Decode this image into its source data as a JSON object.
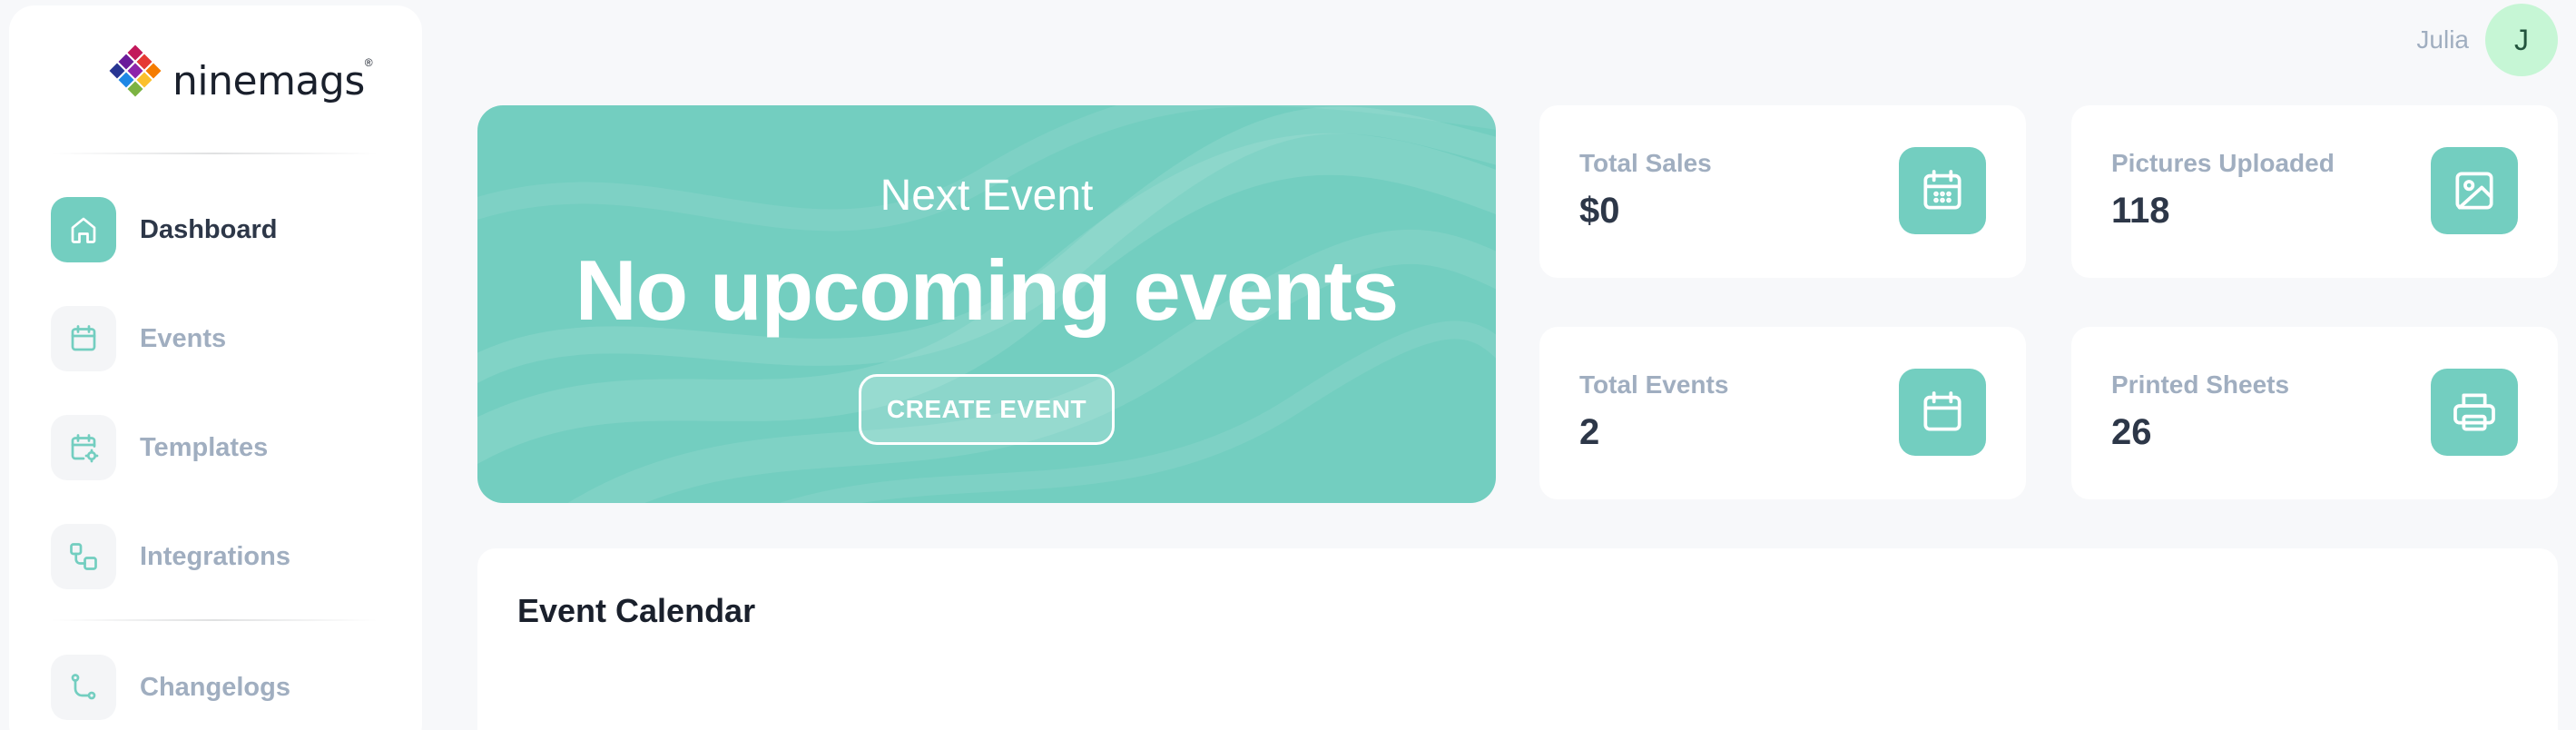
{
  "brand": {
    "name": "ninemags",
    "reg": "®"
  },
  "colors": {
    "accent": "#73cec0",
    "muted": "#a0aec0",
    "text": "#2d3748",
    "avatar_bg": "#c6f6d5"
  },
  "sidebar": {
    "items": [
      {
        "label": "Dashboard",
        "icon": "home-icon",
        "active": true
      },
      {
        "label": "Events",
        "icon": "calendar-icon",
        "active": false
      },
      {
        "label": "Templates",
        "icon": "calendar-settings-icon",
        "active": false
      },
      {
        "label": "Integrations",
        "icon": "integrations-icon",
        "active": false
      },
      {
        "label": "Changelogs",
        "icon": "git-branch-icon",
        "active": false
      }
    ]
  },
  "user": {
    "name": "Julia",
    "initial": "J"
  },
  "hero": {
    "subtitle": "Next Event",
    "title": "No upcoming events",
    "button_label": "CREATE EVENT"
  },
  "stats": [
    {
      "label": "Total Sales",
      "value": "$0",
      "icon": "calendar-grid-icon"
    },
    {
      "label": "Pictures Uploaded",
      "value": "118",
      "icon": "image-icon"
    },
    {
      "label": "Total Events",
      "value": "2",
      "icon": "calendar-icon"
    },
    {
      "label": "Printed Sheets",
      "value": "26",
      "icon": "printer-icon"
    }
  ],
  "calendar": {
    "title": "Event Calendar"
  }
}
